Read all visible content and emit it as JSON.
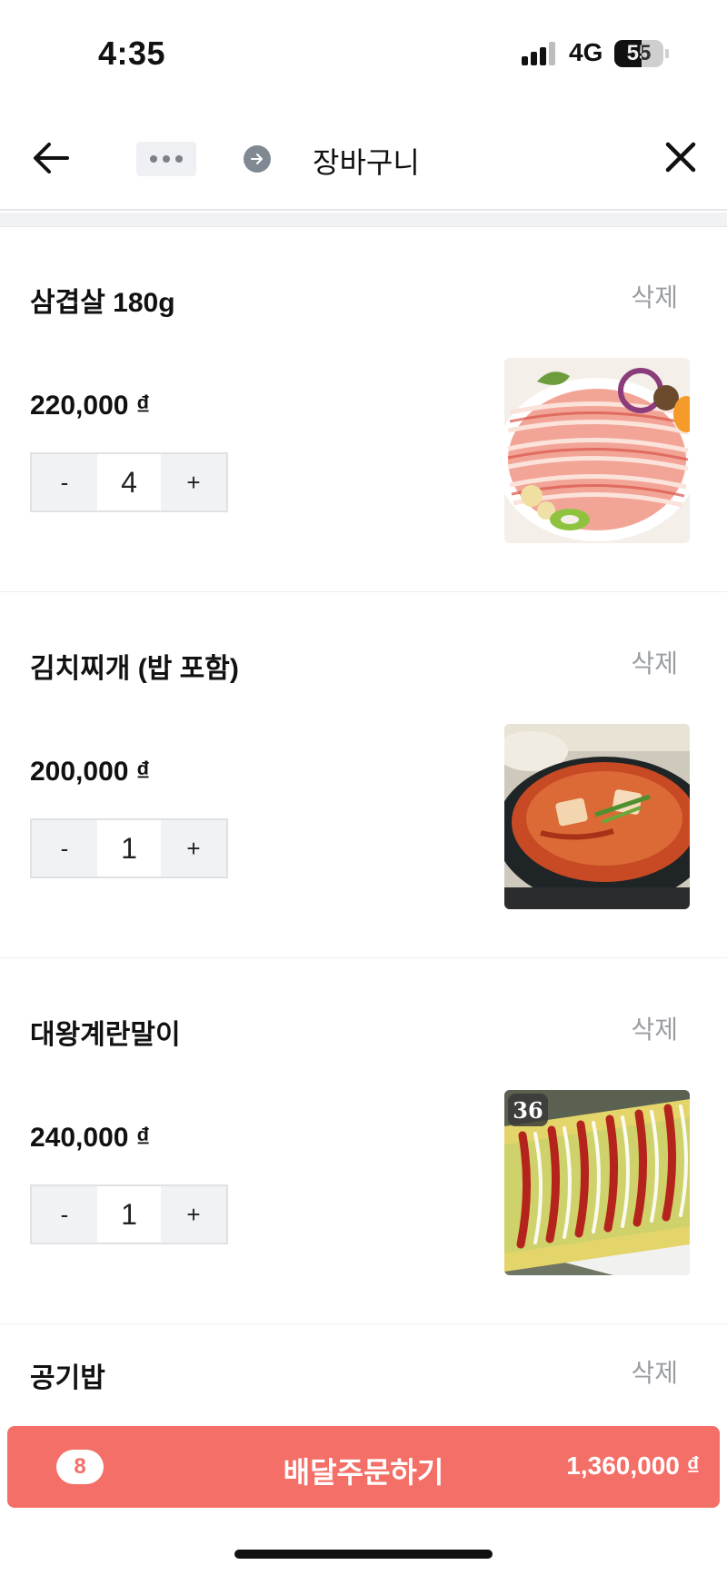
{
  "status_bar": {
    "time": "4:35",
    "network": "4G",
    "battery": "55",
    "battery_level": 0.55
  },
  "nav": {
    "title": "장바구니",
    "back_icon": "arrow-left-icon",
    "more_icon": "more-horizontal-icon",
    "share_icon": "arrow-right-circle-icon",
    "close_icon": "close-icon"
  },
  "cart": {
    "items": [
      {
        "name": "삼겹살 180g",
        "delete": "삭제",
        "price": "220,000 ₫",
        "quantity": "4",
        "decrement": "-",
        "increment": "+",
        "image": "grilled-pork-belly-photo"
      },
      {
        "name": "김치찌개 (밥 포함)",
        "delete": "삭제",
        "price": "200,000 ₫",
        "quantity": "1",
        "decrement": "-",
        "increment": "+",
        "image": "kimchi-stew-photo"
      },
      {
        "name": "대왕계란말이",
        "delete": "삭제",
        "price": "240,000 ₫",
        "quantity": "1",
        "decrement": "-",
        "increment": "+",
        "image": "rolled-omelette-photo",
        "image_badge": "36"
      },
      {
        "name": "공기밥",
        "delete": "삭제"
      }
    ]
  },
  "order": {
    "count": "8",
    "label": "배달주문하기",
    "total": "1,360,000 ₫",
    "accent_color": "#f36f67"
  }
}
